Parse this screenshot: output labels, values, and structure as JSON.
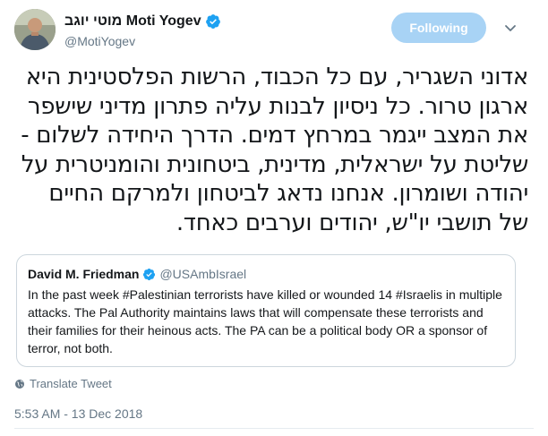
{
  "author": {
    "display_name": "מוטי יוגב Moti Yogev",
    "handle": "@MotiYogev",
    "verified": true
  },
  "follow_button": {
    "label": "Following"
  },
  "tweet_text": "אדוני השגריר, עם כל הכבוד, הרשות הפלסטינית היא ארגון טרור. כל ניסיון לבנות עליה פתרון מדיני שישפר את המצב ייגמר במרחץ דמים. הדרך היחידה לשלום - שליטת על ישראלית, מדינית, ביטחונית והומניטרית על יהודה ושומרון. אנחנו נדאג לביטחון ולמרקם החיים של תושבי יו\"ש, יהודים וערבים כאחד.",
  "quoted_tweet": {
    "display_name": "David M. Friedman",
    "handle": "@USAmbIsrael",
    "verified": true,
    "text": "In the past week #Palestinian terrorists have killed or wounded 14 #Israelis in multiple attacks. The Pal Authority maintains laws that will compensate these terrorists and their families for their heinous acts. The PA can be a political body OR a sponsor of terror, not both."
  },
  "translate": {
    "label": "Translate Tweet"
  },
  "timestamp": "5:53 AM - 13 Dec 2018",
  "colors": {
    "verified_blue": "#1da1f2",
    "follow_bg": "#a8d3f5",
    "secondary_text": "#657786"
  },
  "icons": [
    "verified-badge-icon",
    "chevron-down-icon",
    "globe-icon"
  ]
}
